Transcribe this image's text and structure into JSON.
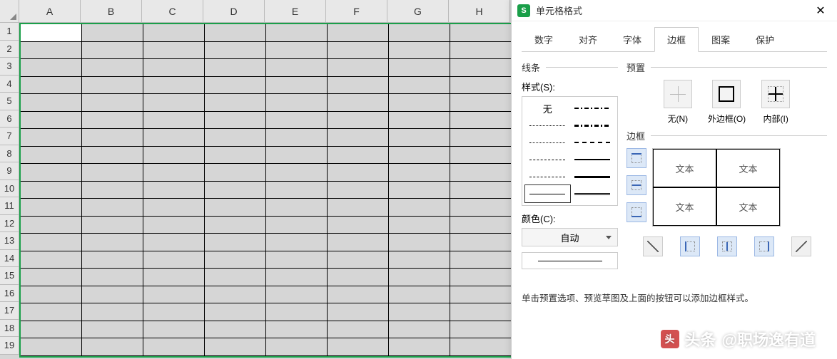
{
  "sheet": {
    "columns": [
      "A",
      "B",
      "C",
      "D",
      "E",
      "F",
      "G",
      "H"
    ],
    "rows": [
      "1",
      "2",
      "3",
      "4",
      "5",
      "6",
      "7",
      "8",
      "9",
      "10",
      "11",
      "12",
      "13",
      "14",
      "15",
      "16",
      "17",
      "18",
      "19"
    ]
  },
  "dialog": {
    "title": "单元格格式",
    "tabs": [
      "数字",
      "对齐",
      "字体",
      "边框",
      "图案",
      "保护"
    ],
    "active_tab": 3,
    "line_group": "线条",
    "style_label": "样式(S):",
    "style_none": "无",
    "color_label": "颜色(C):",
    "color_value": "自动",
    "preset_group": "预置",
    "preset_none": "无(N)",
    "preset_outer": "外边框(O)",
    "preset_inner": "内部(I)",
    "border_group": "边框",
    "sample_text": "文本",
    "hint": "单击预置选项、预览草图及上面的按钮可以添加边框样式。"
  },
  "watermark": {
    "prefix": "头条",
    "handle": "@职场逸有道"
  }
}
